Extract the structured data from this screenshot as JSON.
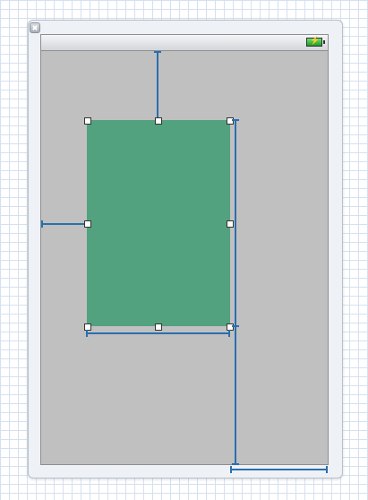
{
  "canvas": {
    "background": "grid-paper",
    "grid_color": "#d6e1ee"
  },
  "window": {
    "close_icon": "close-icon"
  },
  "device": {
    "screen_color": "#c0c0c0",
    "status_bar": {
      "battery_icon": "battery-charging-icon",
      "battery_color": "#2fb43c"
    }
  },
  "selected_view": {
    "color": "#52a27f",
    "selected": true,
    "resize_handles": 8
  },
  "constraints": {
    "color": "#2a6fb0",
    "items": [
      "top-space",
      "leading-space",
      "width",
      "height",
      "trailing-space",
      "bottom-space"
    ]
  }
}
